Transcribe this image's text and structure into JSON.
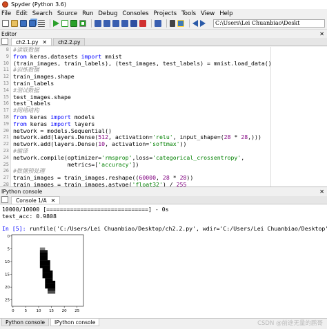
{
  "window": {
    "title": "Spyder (Python 3.6)"
  },
  "menu": [
    "File",
    "Edit",
    "Search",
    "Source",
    "Run",
    "Debug",
    "Consoles",
    "Projects",
    "Tools",
    "View",
    "Help"
  ],
  "toolbar": {
    "path": "C:\\Users\\Lei Chuanbiao\\Deskt"
  },
  "editor": {
    "pane_label": "Editor",
    "tabs": [
      {
        "label": "ch2.1.py",
        "active": true
      },
      {
        "label": "ch2.2.py",
        "active": false
      }
    ],
    "line_numbers": [
      "8",
      "9",
      "10",
      "11",
      "12",
      "13",
      "14",
      "15",
      "16",
      "17",
      "18",
      "19",
      "20",
      "21",
      "22",
      "23",
      "24",
      "25",
      "26",
      "27",
      "28"
    ]
  },
  "console": {
    "pane_label": "IPython console",
    "tab_label": "Console 1/A",
    "progress_line": "10000/10000 [==============================] - 0s",
    "acc_line": "test_acc: 0.9808",
    "prompt": "In [5]:",
    "command": "runfile('C:/Users/Lei Chuanbiao/Desktop/ch2.2.py', wdir='C:/Users/Lei Chuanbiao/Desktop')"
  },
  "plot": {
    "y_ticks": [
      "0",
      "5",
      "10",
      "15",
      "20",
      "25"
    ],
    "x_ticks": [
      "0",
      "5",
      "10",
      "15",
      "20",
      "25"
    ]
  },
  "bottom_tabs": [
    {
      "label": "Python console",
      "active": false
    },
    {
      "label": "IPython console",
      "active": true
    }
  ],
  "watermark": "CSDN @前途无量的鹏哥"
}
